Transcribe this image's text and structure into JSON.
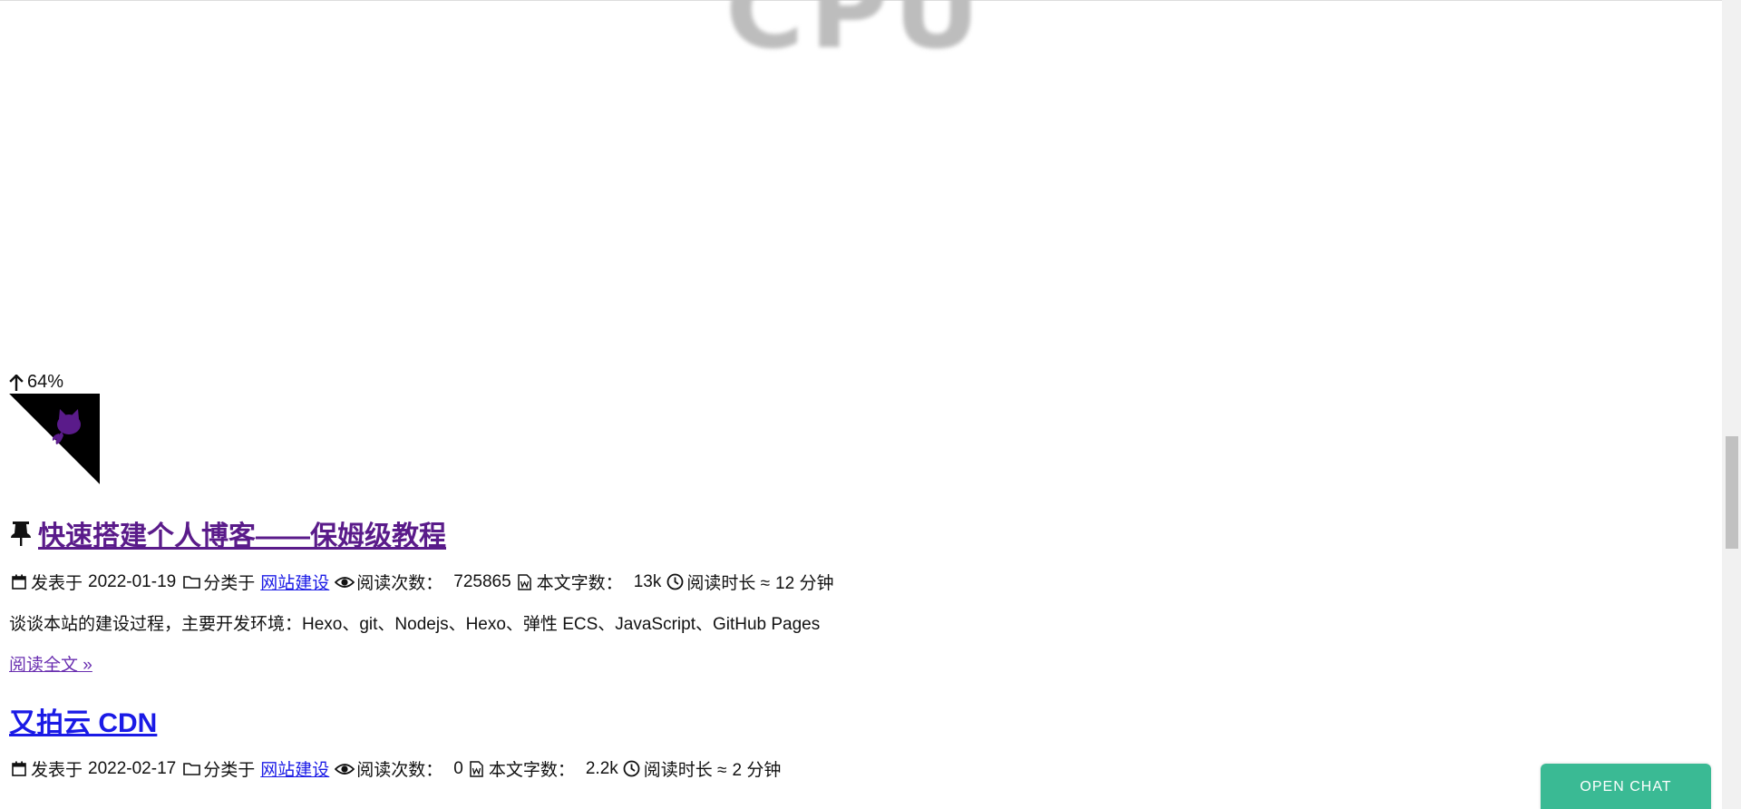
{
  "header_image": {
    "ghost_text": "CPU"
  },
  "progress": {
    "label": "64%",
    "value_percent": 64,
    "icon": "arrow-up-icon"
  },
  "github_corner": {
    "icon": "github-octocat-icon",
    "colors": {
      "triangle": "#000000",
      "octocat": "#5a1b8a"
    }
  },
  "posts": [
    {
      "pinned": true,
      "pin_icon": "thumbtack-icon",
      "title": "快速搭建个人博客——保姆级教程",
      "published_label": "发表于",
      "published_date": "2022-01-19",
      "category_label": "分类于",
      "category": "网站建设",
      "views_label": "阅读次数：",
      "views": "725865",
      "words_label": "本文字数：",
      "words": "13k",
      "read_time_label": "阅读时长 ≈",
      "read_time": "12 分钟",
      "excerpt": "谈谈本站的建设过程，主要开发环境：Hexo、git、Nodejs、Hexo、弹性 ECS、JavaScript、GitHub Pages",
      "read_more": "阅读全文 »"
    },
    {
      "pinned": false,
      "title": "又拍云 CDN",
      "published_label": "发表于",
      "published_date": "2022-02-17",
      "category_label": "分类于",
      "category": "网站建设",
      "views_label": "阅读次数：",
      "views": "0",
      "words_label": "本文字数：",
      "words": "2.2k",
      "read_time_label": "阅读时长 ≈",
      "read_time": "2 分钟"
    }
  ],
  "chat": {
    "label": "OPEN CHAT",
    "color": "#3aba94"
  },
  "colors": {
    "link": "#1a1ae6",
    "visited": "#5a1b8a"
  }
}
